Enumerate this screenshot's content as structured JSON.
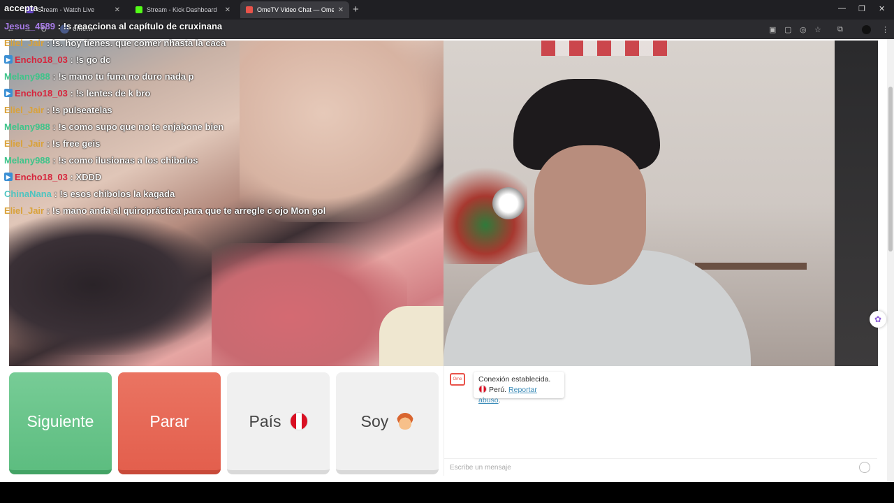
{
  "browser": {
    "tabs": [
      {
        "title": "Stream - Watch Live",
        "favicon_color": "#6d4bd6",
        "active": false
      },
      {
        "title": "Stream - Kick Dashboard",
        "favicon_color": "#53fc18",
        "active": false
      },
      {
        "title": "OmeTV Video Chat — Ome",
        "favicon_color": "#e9534a",
        "active": true
      }
    ],
    "url": "ome.tv"
  },
  "overlay_label": "accepta :",
  "chat": [
    {
      "user": "Jesus_4589",
      "user_color": "#a77be6",
      "badge": false,
      "msg": "!s reacciona al capítulo de cruxinana"
    },
    {
      "user": "Eliel_Jair",
      "user_color": "#d9a23a",
      "badge": false,
      "msg": "!s. hoy tienes. que comer nhasta la caca"
    },
    {
      "user": "Encho18_03",
      "user_color": "#d6253c",
      "badge": true,
      "msg": "!s go dc"
    },
    {
      "user": "Melany988",
      "user_color": "#3ec48a",
      "badge": false,
      "msg": "!s mano tu funa no duro nada p"
    },
    {
      "user": "Encho18_03",
      "user_color": "#d6253c",
      "badge": true,
      "msg": "!s lentes de k bro"
    },
    {
      "user": "Eliel_Jair",
      "user_color": "#d9a23a",
      "badge": false,
      "msg": "!s pulseatelas"
    },
    {
      "user": "Melany988",
      "user_color": "#3ec48a",
      "badge": false,
      "msg": "!s como supo que no te enjabone bien"
    },
    {
      "user": "Eliel_Jair",
      "user_color": "#d9a23a",
      "badge": false,
      "msg": "!s free geis"
    },
    {
      "user": "Melany988",
      "user_color": "#3ec48a",
      "badge": false,
      "msg": "!s como ilusionas a los chibolos"
    },
    {
      "user": "Encho18_03",
      "user_color": "#d6253c",
      "badge": true,
      "msg": "XDDD"
    },
    {
      "user": "ChinaNana",
      "user_color": "#4fc4c0",
      "badge": false,
      "msg": "!s esos chibolos la kagada"
    },
    {
      "user": "Eliel_Jair",
      "user_color": "#d9a23a",
      "badge": false,
      "msg": "!s mano anda al quiropráctica para que te arregle c ojo Mon gol"
    }
  ],
  "controls": {
    "next": "Siguiente",
    "stop": "Parar",
    "country": "País",
    "gender": "Soy"
  },
  "chatpanel": {
    "status": "Conexión establecida.",
    "country": "Perú.",
    "report": "Reportar abuso",
    "input_placeholder": "Escribe un mensaje"
  },
  "colors": {
    "next": "#5dbd80",
    "stop": "#e35f4d"
  }
}
